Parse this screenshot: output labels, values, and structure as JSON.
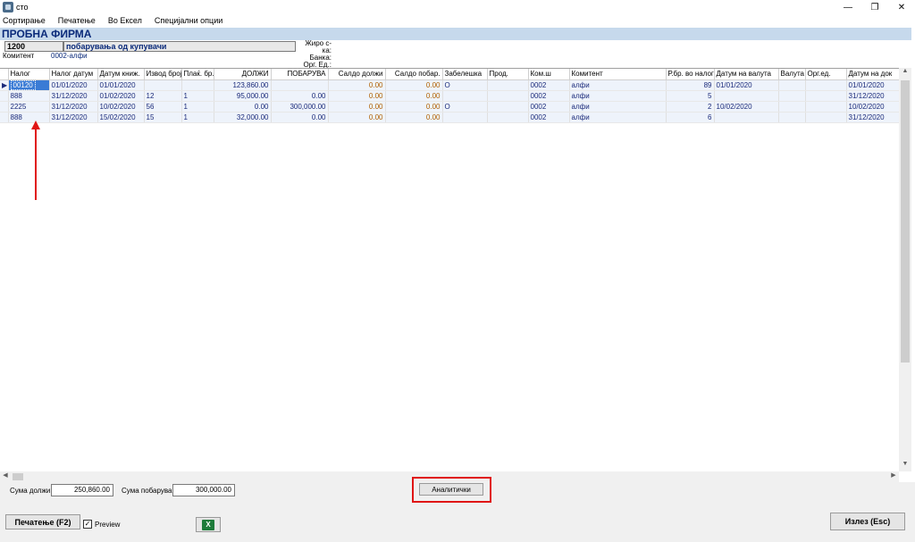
{
  "window": {
    "title": "сто",
    "minimize_glyph": "—",
    "restore_glyph": "❐",
    "close_glyph": "✕"
  },
  "menu": {
    "items": [
      {
        "label": "Сортирање"
      },
      {
        "label": "Печатење"
      },
      {
        "label": "Во Ексел"
      },
      {
        "label": "Специјални опции"
      }
    ]
  },
  "company": {
    "title": "ПРОБНА ФИРМА",
    "account_code": "1200",
    "account_name": "побарувања од купувачи",
    "komitent_label": "Комитент",
    "komitent_value": "0002-алфи",
    "right_labels": [
      "Жиро с-ка:",
      "Банка:",
      "Орг. Ед.:"
    ]
  },
  "grid": {
    "columns": [
      "Налог",
      "Налог датум",
      "Датум книж.",
      "Извод број",
      "Плаќ. бр.",
      "ДОЛЖИ",
      "ПОБАРУВА",
      "Салдо должи",
      "Салдо побар.",
      "Забелешка",
      "Прод.",
      "Ком.ш",
      "Комитент",
      "Р.бр. во налог",
      "Датум на валута",
      "Валута",
      "Орг.ед.",
      "Датум на док"
    ],
    "rows": [
      {
        "nalog": "00120",
        "nalog_datum": "01/01/2020",
        "datum_knizh": "01/01/2020",
        "izvod": "",
        "plak": "",
        "dolzhi": "123,860.00",
        "pobaruva": "",
        "saldo_d": "0.00",
        "saldo_p": "0.00",
        "zabeleshka": "О",
        "prod": "",
        "kom": "0002",
        "komitent": "алфи",
        "rbr": "89",
        "datum_valuta": "01/01/2020",
        "valuta": "",
        "org": "",
        "datum_dok": "01/01/2020"
      },
      {
        "nalog": "888",
        "nalog_datum": "31/12/2020",
        "datum_knizh": "01/02/2020",
        "izvod": "12",
        "plak": "1",
        "dolzhi": "95,000.00",
        "pobaruva": "0.00",
        "saldo_d": "0.00",
        "saldo_p": "0.00",
        "zabeleshka": "",
        "prod": "",
        "kom": "0002",
        "komitent": "алфи",
        "rbr": "5",
        "datum_valuta": "",
        "valuta": "",
        "org": "",
        "datum_dok": "31/12/2020"
      },
      {
        "nalog": "2225",
        "nalog_datum": "31/12/2020",
        "datum_knizh": "10/02/2020",
        "izvod": "56",
        "plak": "1",
        "dolzhi": "0.00",
        "pobaruva": "300,000.00",
        "saldo_d": "0.00",
        "saldo_p": "0.00",
        "zabeleshka": "О",
        "prod": "",
        "kom": "0002",
        "komitent": "алфи",
        "rbr": "2",
        "datum_valuta": "10/02/2020",
        "valuta": "",
        "org": "",
        "datum_dok": "10/02/2020"
      },
      {
        "nalog": "888",
        "nalog_datum": "31/12/2020",
        "datum_knizh": "15/02/2020",
        "izvod": "15",
        "plak": "1",
        "dolzhi": "32,000.00",
        "pobaruva": "0.00",
        "saldo_d": "0.00",
        "saldo_p": "0.00",
        "zabeleshka": "",
        "prod": "",
        "kom": "0002",
        "komitent": "алфи",
        "rbr": "6",
        "datum_valuta": "",
        "valuta": "",
        "org": "",
        "datum_dok": "31/12/2020"
      }
    ],
    "row_indicator": "▶"
  },
  "scroll": {
    "up": "▲",
    "down": "▼",
    "left": "◀",
    "right": "▶"
  },
  "footer": {
    "sum_dolzhi_label": "Сума должи",
    "sum_dolzhi_value": "250,860.00",
    "sum_pobaruva_label": "Сума побарува",
    "sum_pobaruva_value": "300,000.00",
    "analytics_button": "Аналитички",
    "print_button": "Печатење (F2)",
    "preview_label": "Preview",
    "preview_checked": "✓",
    "exit_button": "Излез (Esc)",
    "excel_glyph": "X"
  },
  "colors": {
    "header_band": "#c6d9ec",
    "company_title": "#0a2a7a",
    "saldo_text": "#b06000",
    "annotation_red": "#e01515",
    "selection": "#3a7bd5"
  }
}
